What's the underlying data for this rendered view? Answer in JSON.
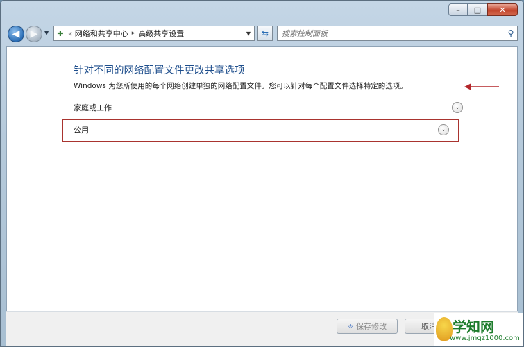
{
  "titlebar": {
    "minimize": "–",
    "maximize": "□",
    "close": "✕"
  },
  "nav": {
    "back_glyph": "◀",
    "forward_glyph": "▶",
    "address": {
      "overflow": "«",
      "crumb1": "网络和共享中心",
      "separator": "▸",
      "crumb2": "高级共享设置"
    },
    "search_placeholder": "搜索控制面板"
  },
  "content": {
    "heading": "针对不同的网络配置文件更改共享选项",
    "description": "Windows 为您所使用的每个网络创建单独的网络配置文件。您可以针对每个配置文件选择特定的选项。",
    "profiles": [
      {
        "label": "家庭或工作"
      },
      {
        "label": "公用"
      }
    ],
    "expand_glyph": "⌄"
  },
  "footer": {
    "save_label": "保存修改",
    "cancel_label": "取消"
  },
  "watermark": {
    "title": "学知网",
    "url": "www.jmqz1000.com"
  },
  "colors": {
    "heading": "#1e4e8c",
    "highlight_border": "#a9342f",
    "arrow": "#b3262a"
  }
}
